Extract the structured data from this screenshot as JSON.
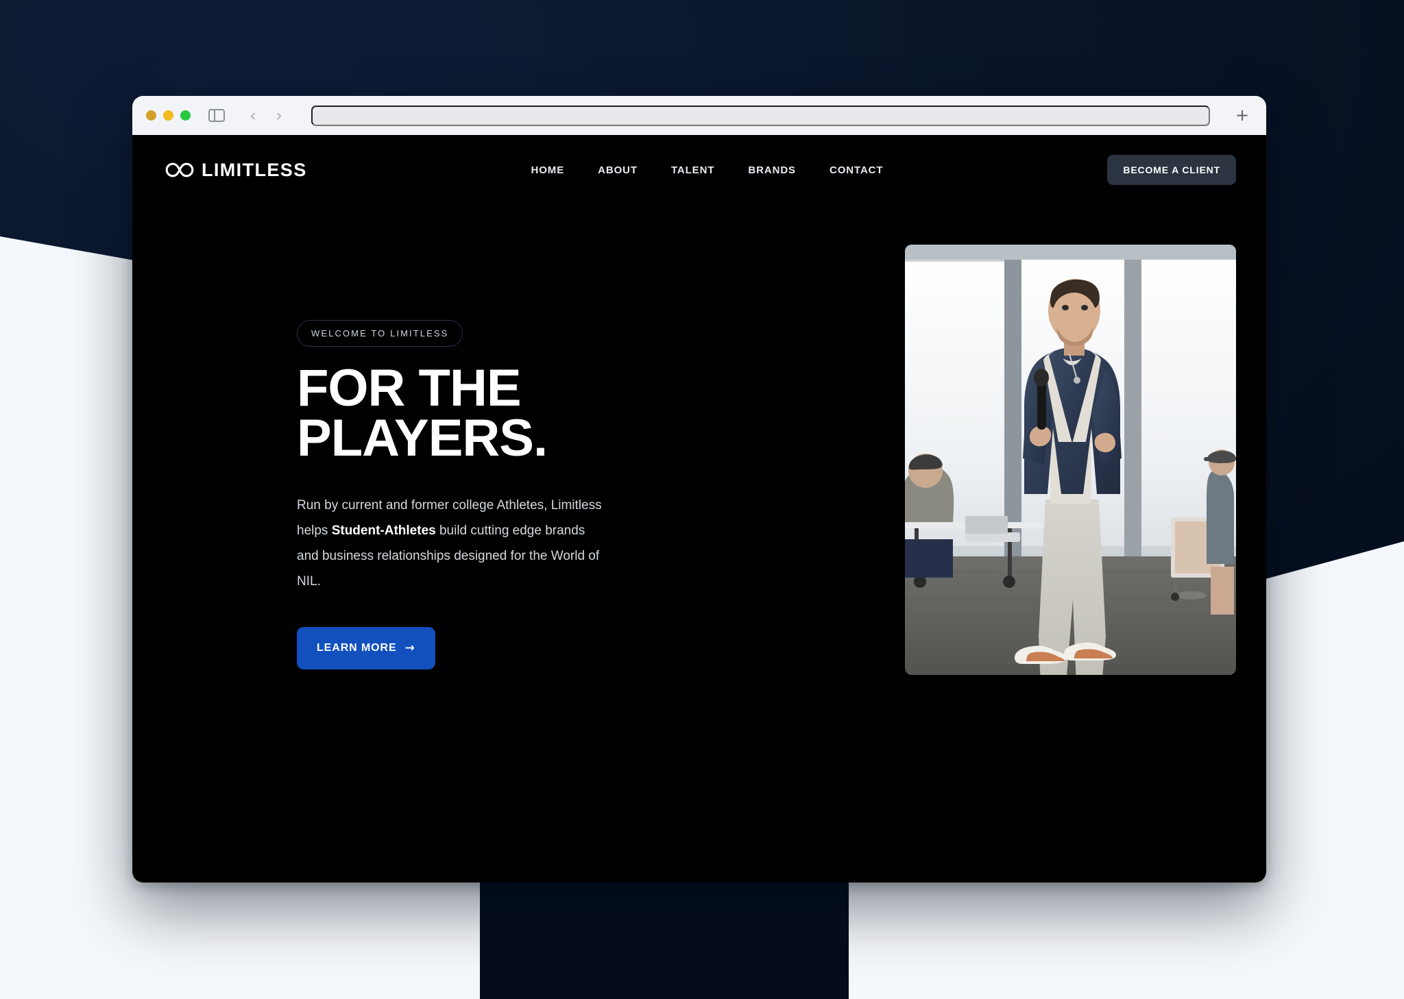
{
  "browser": {
    "traffic_lights": [
      "close",
      "minimize",
      "maximize"
    ],
    "sidebar_icon": "sidebar-toggle-icon",
    "back_icon": "‹",
    "forward_icon": "›",
    "address_value": "",
    "address_placeholder": "",
    "new_tab_icon": "+"
  },
  "site": {
    "logo": {
      "mark": "infinity-icon",
      "text": "LIMITLESS"
    },
    "nav": [
      {
        "label": "HOME"
      },
      {
        "label": "ABOUT"
      },
      {
        "label": "TALENT"
      },
      {
        "label": "BRANDS"
      },
      {
        "label": "CONTACT"
      }
    ],
    "cta_header": "BECOME A CLIENT",
    "hero": {
      "badge": "WELCOME TO LIMITLESS",
      "title_line1": "FOR THE",
      "title_line2": "PLAYERS.",
      "paragraph_part1": "Run by current and former college Athletes, Limitless helps ",
      "paragraph_bold": "Student-Athletes",
      "paragraph_part2": " build cutting edge brands and business relationships designed for the World of NIL.",
      "cta_label": "LEARN MORE",
      "cta_arrow": "→",
      "photo_alt": "man-in-navy-blazer-speaking-with-microphone"
    }
  },
  "colors": {
    "accent_blue": "#1250be",
    "header_glow": "#1b4a91",
    "page_black": "#000000",
    "desktop_navy": "#0b1a33",
    "wedge_white": "#f4f7fb",
    "header_cta": "#2b3440"
  }
}
